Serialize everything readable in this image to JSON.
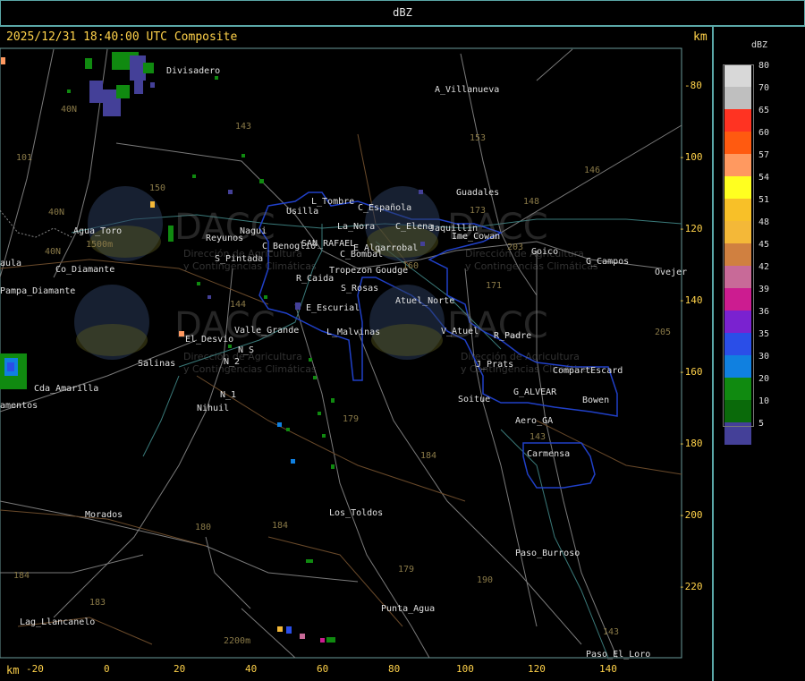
{
  "header": {
    "title": "dBZ"
  },
  "timestamp": "2025/12/31 18:40:00 UTC Composite",
  "axis": {
    "unit_top": "km",
    "unit_bottom": "km",
    "x_ticks": [
      "-20",
      "0",
      "20",
      "40",
      "60",
      "80",
      "100",
      "120",
      "140"
    ],
    "y_ticks": [
      "-80",
      "-100",
      "-120",
      "-140",
      "-160",
      "-180",
      "-200",
      "-220"
    ]
  },
  "legend": {
    "title": "dBZ",
    "entries": [
      {
        "label": "80",
        "color": "#d8d8d8"
      },
      {
        "label": "70",
        "color": "#bfbfbf"
      },
      {
        "label": "65",
        "color": "#ff3322"
      },
      {
        "label": "60",
        "color": "#ff5a10"
      },
      {
        "label": "57",
        "color": "#ff9960"
      },
      {
        "label": "54",
        "color": "#ffff20"
      },
      {
        "label": "51",
        "color": "#f8c028"
      },
      {
        "label": "48",
        "color": "#f4b838"
      },
      {
        "label": "45",
        "color": "#d08040"
      },
      {
        "label": "42",
        "color": "#c86a98"
      },
      {
        "label": "39",
        "color": "#cc1c90"
      },
      {
        "label": "36",
        "color": "#7a22d0"
      },
      {
        "label": "35",
        "color": "#2a4ee8"
      },
      {
        "label": "30",
        "color": "#1080e0"
      },
      {
        "label": "20",
        "color": "#108a10"
      },
      {
        "label": "10",
        "color": "#0a6a0a"
      },
      {
        "label": "5",
        "color": "#444098"
      }
    ]
  },
  "watermark": {
    "brand": "DACC",
    "line1": "Dirección de Agricultura",
    "line2": "y Contingencias Climáticas"
  },
  "places": [
    "Divisadero",
    "A_Villanueva",
    "Guadales",
    "L_Tombre",
    "Usilla",
    "C_Española",
    "La_Nora",
    "C_Elena",
    "Jaquillin",
    "Ime_Cowan",
    "Goico",
    "G_Campos",
    "Ovejer",
    "Agua_Toro",
    "Reyunos",
    "Nagui",
    "C_Benoglio",
    "SAN_RAFAEL",
    "C_Bombal",
    "E_Algarrobal",
    "S_Pintada",
    "R_Caida",
    "Tropezon",
    "Goudge",
    "S_Rosas",
    "Atuel_Norte",
    "Pampa_Diamante",
    "Co_Diamante",
    "aula",
    "E_Escurial",
    "V_Atuel",
    "R_Padre",
    "El_Desvio",
    "Valle_Grande",
    "L_Malvinas",
    "J_Prats",
    "CompartEscard",
    "Salinas",
    "N_2",
    "N_S",
    "N_1",
    "Nihuil",
    "Cda_Amarilla",
    "amentos",
    "G_ALVEAR",
    "Soitue",
    "Bowen",
    "Aero_GA",
    "Carmensa",
    "Morados",
    "Los_Toldos",
    "Paso_Burroso",
    "Punta_Agua",
    "Lag_Llancanelo",
    "Paso_El_Loro",
    "1500m",
    "2200m"
  ],
  "routes": [
    "101",
    "40N",
    "40N",
    "40N",
    "143",
    "153",
    "146",
    "150",
    "148",
    "173",
    "203",
    "160",
    "171",
    "184",
    "179",
    "180",
    "184",
    "184",
    "183",
    "190",
    "143",
    "143",
    "179",
    "205",
    "144"
  ]
}
